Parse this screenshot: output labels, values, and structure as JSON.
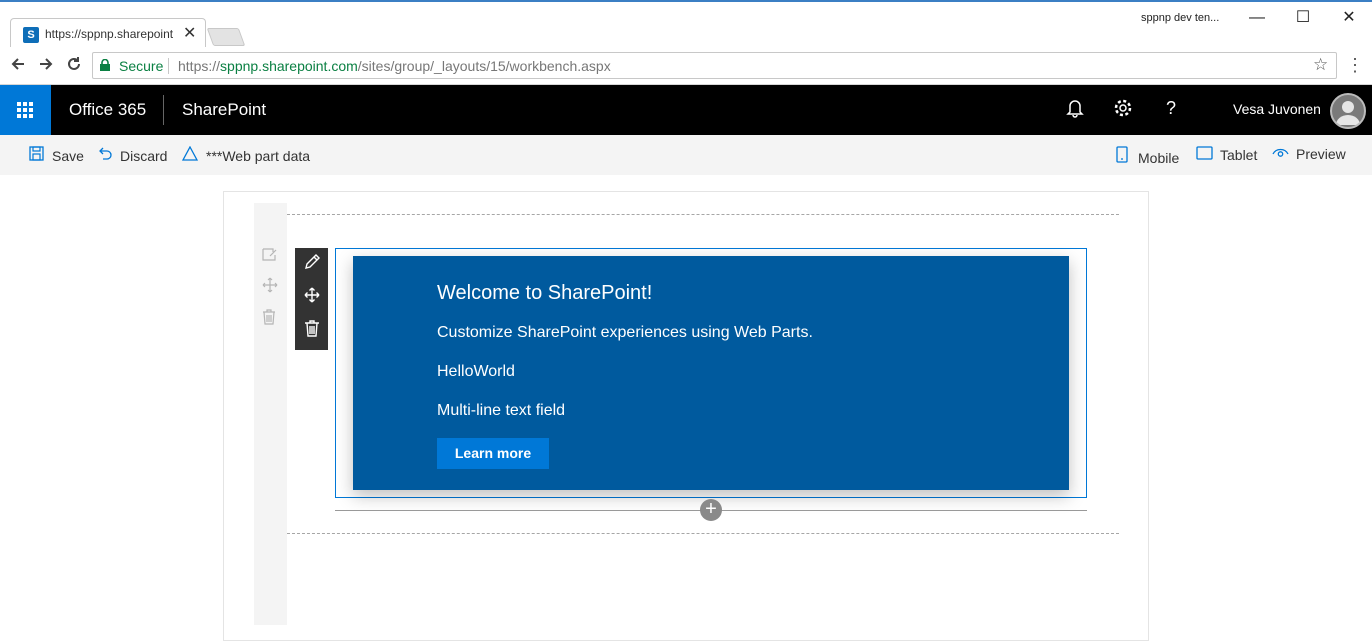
{
  "browser": {
    "tab_title": "https://sppnp.sharepoint",
    "tab_favicon": "S",
    "tab_close": "✕",
    "window_title": "sppnp dev ten...",
    "secure_label": "Secure",
    "url_scheme": "https://",
    "url_host": "sppnp.sharepoint.com",
    "url_path": "/sites/group/_layouts/15/workbench.aspx",
    "icons": {
      "back": "arrow-left-icon",
      "forward": "arrow-right-icon",
      "reload": "reload-icon",
      "lock": "lock-icon",
      "star": "star-icon",
      "menu": "kebab-menu-icon"
    },
    "window_controls": {
      "minimize": "—",
      "maximize": "☐",
      "close": "✕"
    }
  },
  "suitebar": {
    "office_label": "Office 365",
    "app_label": "SharePoint",
    "user_name": "Vesa Juvonen",
    "accent_color": "#0078d7",
    "icons": [
      "bell-icon",
      "gear-icon",
      "help-icon"
    ],
    "help_glyph": "?"
  },
  "commandbar": {
    "save_label": "Save",
    "discard_label": "Discard",
    "webpart_data_label": "***Web part data",
    "mobile_label": "Mobile",
    "tablet_label": "Tablet",
    "preview_label": "Preview"
  },
  "webpart": {
    "title": "Welcome to SharePoint!",
    "subtitle": "Customize SharePoint experiences using Web Parts.",
    "description": "HelloWorld",
    "multiline": "Multi-line text field",
    "button_label": "Learn more",
    "background_color": "#005a9e",
    "button_color": "#0078d7"
  }
}
